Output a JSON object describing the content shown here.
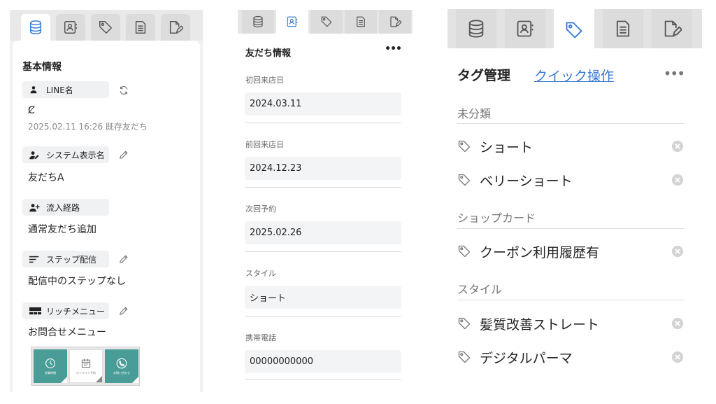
{
  "panel_basic": {
    "tabs": [
      {
        "icon": "database-icon",
        "active": true
      },
      {
        "icon": "contact-card-icon",
        "active": false
      },
      {
        "icon": "tag-icon",
        "active": false
      },
      {
        "icon": "document-icon",
        "active": false
      },
      {
        "icon": "edit-document-icon",
        "active": false
      }
    ],
    "title": "基本情報",
    "line_name": {
      "label": "LINE名",
      "value": "Ȼ",
      "sub": "2025.02.11 16:26 既存友だち"
    },
    "system_name": {
      "label": "システム表示名",
      "value": "友だちA"
    },
    "source": {
      "label": "流入経路",
      "value": "通常友だち追加"
    },
    "step": {
      "label": "ステップ配信",
      "value": "配信中のステップなし"
    },
    "rich_menu": {
      "label": "リッチメニュー",
      "value": "お問合せメニュー",
      "cells": [
        {
          "text": "営業時間"
        },
        {
          "text": "オンライン予約"
        },
        {
          "text": "お問い合わせ"
        }
      ]
    }
  },
  "panel_friend": {
    "title": "友だち情報",
    "more": "•••",
    "fields": [
      {
        "label": "初回来店日",
        "value": "2024.03.11"
      },
      {
        "label": "前回来店日",
        "value": "2024.12.23"
      },
      {
        "label": "次回予約",
        "value": "2025.02.26"
      },
      {
        "label": "スタイル",
        "value": "ショート"
      },
      {
        "label": "携帯電話",
        "value": "00000000000"
      }
    ]
  },
  "panel_tags": {
    "title": "タグ管理",
    "quick_link": "クイック操作",
    "more": "•••",
    "categories": [
      {
        "name": "未分類",
        "tags": [
          "ショート",
          "ベリーショート"
        ]
      },
      {
        "name": "ショップカード",
        "tags": [
          "クーポン利用履歴有"
        ]
      },
      {
        "name": "スタイル",
        "tags": [
          "髪質改善ストレート",
          "デジタルパーマ"
        ]
      }
    ]
  },
  "colors": {
    "accent_blue": "#3a7bd5",
    "menu_teal": "#4a9c97",
    "icon_gray": "#555555"
  }
}
